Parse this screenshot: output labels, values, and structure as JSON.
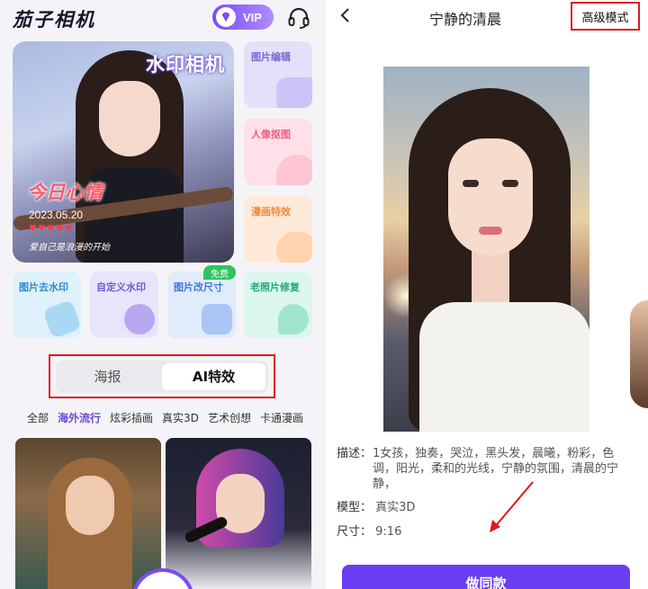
{
  "left": {
    "app_title": "茄子相机",
    "vip_label": "VIP",
    "hero": {
      "title": "水印相机",
      "mood_text": "今日心情",
      "date": "2023.05.20",
      "hearts": "♥♥♥♥♥",
      "caption": "爱自己是浪漫的开始"
    },
    "side_cards": [
      "图片编辑",
      "人像抠图",
      "漫画特效"
    ],
    "tools": [
      "图片去水印",
      "自定义水印",
      "图片改尺寸",
      "老照片修复"
    ],
    "free_badge": "免费",
    "segment": [
      "海报",
      "AI特效"
    ],
    "categories": [
      "全部",
      "海外流行",
      "炫彩插画",
      "真实3D",
      "艺术创想",
      "卡通漫画"
    ]
  },
  "right": {
    "title": "宁静的清晨",
    "advanced_mode": "高级模式",
    "description_label": "描述：",
    "description": "1女孩，独奏，哭泣，黑头发，晨曦，粉彩，色调，阳光，柔和的光线，宁静的氛围，清晨的宁静，",
    "model_label": "模型：",
    "model_value": "真实3D",
    "size_label": "尺寸：",
    "size_value": "9:16",
    "make_same_button": "做同款"
  },
  "colors": {
    "accent_purple": "#6b3df0",
    "highlight_red": "#e0161c",
    "free_green": "#2fc45f"
  }
}
